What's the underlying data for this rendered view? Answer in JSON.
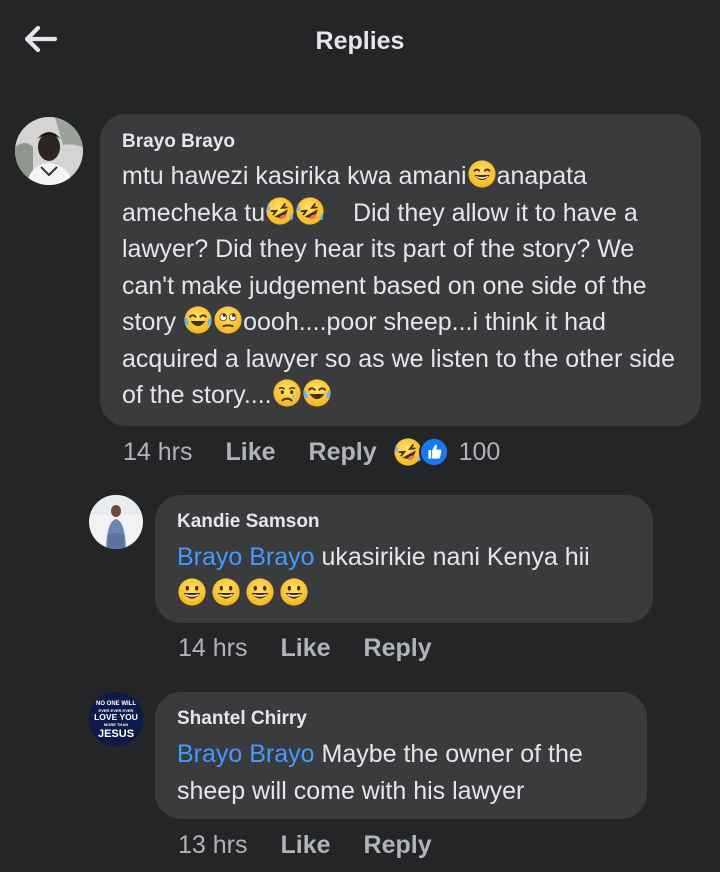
{
  "header": {
    "title": "Replies",
    "back_icon": "back-arrow-icon"
  },
  "colors": {
    "background": "#242526",
    "bubble": "#3a3b3c",
    "mention": "#4599ff",
    "secondary_text": "#b0b3b8",
    "like_blue": "#1877f2"
  },
  "main_comment": {
    "author": "Brayo Brayo",
    "segments": {
      "s1": "mtu hawezi kasirika kwa amani",
      "s2": "anapata amecheka tu",
      "s3": "Did they allow it to have a lawyer? Did they hear its part of the story? We can't make judgement based on one side of the story ",
      "s4": "oooh....poor sheep...i think it had acquired a lawyer  so as we listen to the other side of the story...."
    },
    "time": "14 hrs",
    "like_label": "Like",
    "reply_label": "Reply",
    "reaction_icons": [
      "laugh-reaction-icon",
      "like-reaction-icon"
    ],
    "reaction_count": "100"
  },
  "replies": [
    {
      "author": "Kandie Samson",
      "mention": "Brayo Brayo",
      "text": " ukasirikie nani Kenya hii",
      "time": "14 hrs",
      "like_label": "Like",
      "reply_label": "Reply"
    },
    {
      "author": "Shantel Chirry",
      "mention": "Brayo Brayo",
      "text": " Maybe the owner of the sheep will come with his lawyer",
      "time": "13 hrs",
      "like_label": "Like",
      "reply_label": "Reply",
      "avatar_text": [
        "NO ONE WILL",
        "EVER EVER EVER",
        "LOVE YOU",
        "MORE THAN",
        "JESUS"
      ]
    }
  ]
}
